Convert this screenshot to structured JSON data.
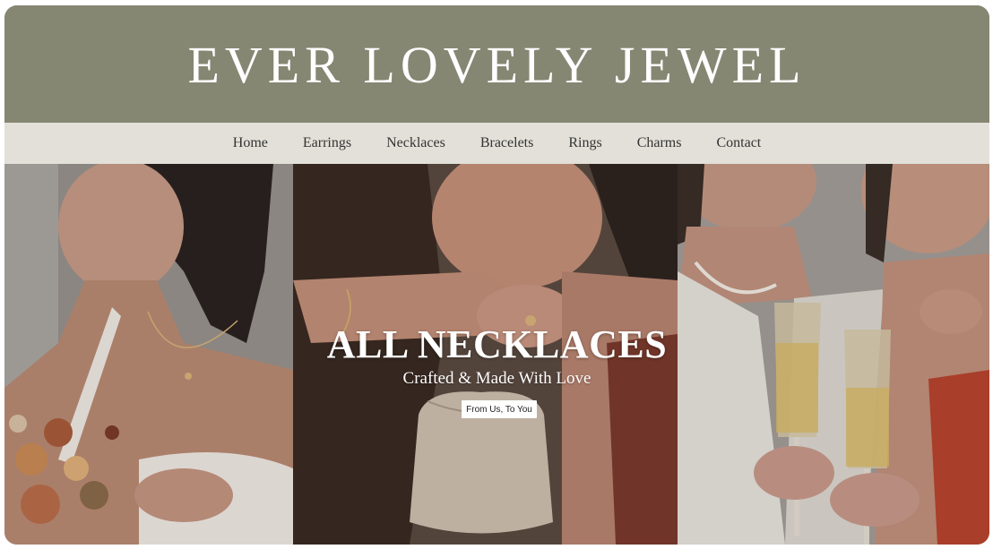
{
  "header": {
    "brand": "EVER LOVELY JEWEL"
  },
  "nav": {
    "items": [
      {
        "label": "Home"
      },
      {
        "label": "Earrings"
      },
      {
        "label": "Necklaces"
      },
      {
        "label": "Bracelets"
      },
      {
        "label": "Rings"
      },
      {
        "label": "Charms"
      },
      {
        "label": "Contact"
      }
    ]
  },
  "hero": {
    "title": "ALL NECKLACES",
    "subtitle": "Crafted & Made With Love",
    "button_label": "From Us, To You"
  },
  "colors": {
    "header_bg": "#868773",
    "nav_bg": "#e2e0d8",
    "nav_text": "#333333",
    "hero_text": "#ffffff",
    "button_bg": "#ffffff"
  }
}
